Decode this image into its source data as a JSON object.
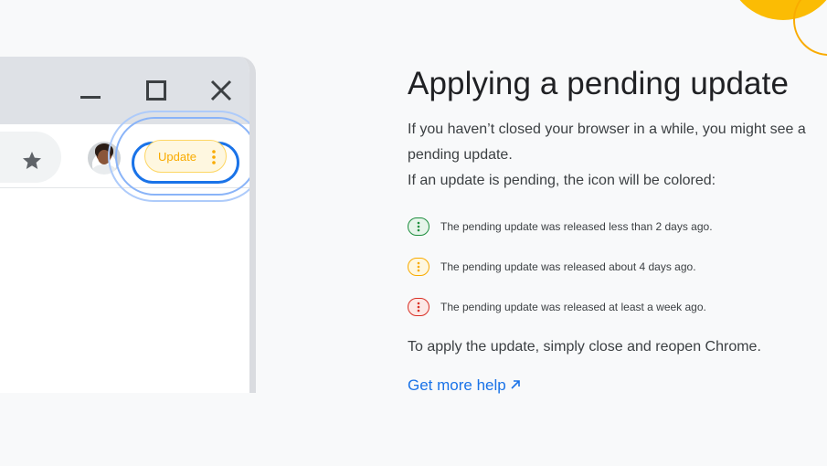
{
  "browser": {
    "update_label": "Update"
  },
  "content": {
    "title": "Applying a pending update",
    "intro_line1": "If you haven’t closed your browser in a while, you might see a pending update.",
    "intro_line2": "If an update is pending, the icon will be colored:",
    "legend": [
      {
        "text": "The pending update was released less than 2 days ago.",
        "color": "#1e8e3e",
        "bg": "#e6f4ea"
      },
      {
        "text": "The pending update was released about 4 days ago.",
        "color": "#f9ab00",
        "bg": "#fef7e0"
      },
      {
        "text": "The pending update was released at least a week ago.",
        "color": "#d93025",
        "bg": "#fce8e6"
      }
    ],
    "apply_text": "To apply the update, simply close and reopen Chrome.",
    "help_link": "Get more help"
  },
  "icons": [
    "minimize-icon",
    "maximize-icon",
    "close-icon",
    "star-icon",
    "kebab-menu-icon",
    "external-link-arrow-icon"
  ],
  "colors": {
    "accent_blue": "#1a73e8",
    "update_yellow": "#f9ab00",
    "deco_yellow": "#fbbc04"
  }
}
